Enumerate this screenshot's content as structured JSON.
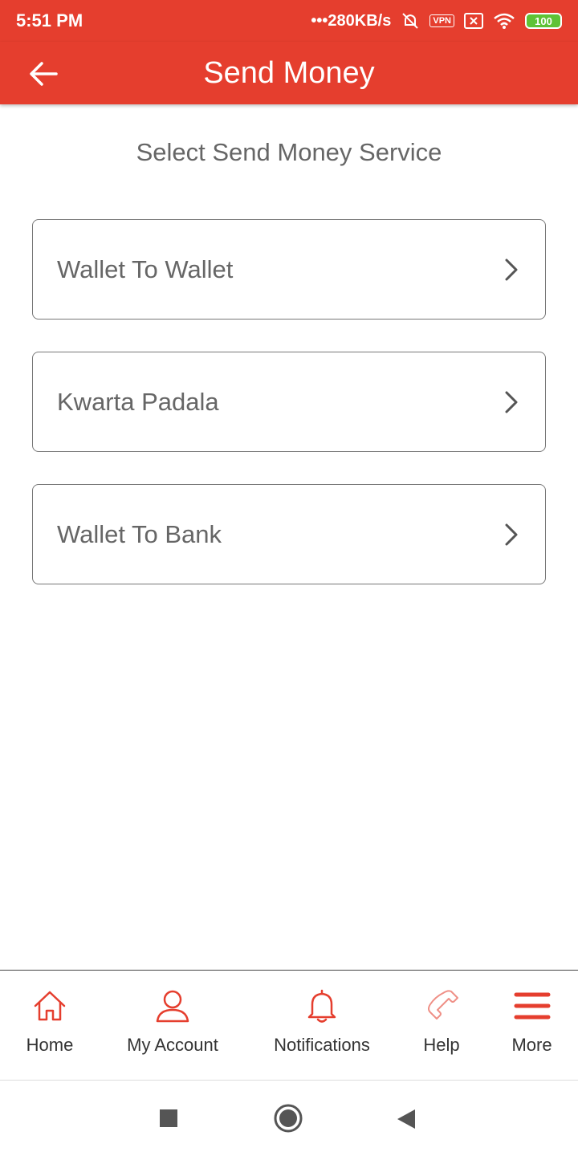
{
  "status_bar": {
    "time": "5:51 PM",
    "network_speed": "•••280KB/s",
    "vpn": "VPN",
    "battery": "100"
  },
  "app_bar": {
    "title": "Send Money"
  },
  "section_title": "Select Send Money Service",
  "options": [
    {
      "label": "Wallet To Wallet"
    },
    {
      "label": "Kwarta Padala"
    },
    {
      "label": "Wallet To Bank"
    }
  ],
  "bottom_nav": {
    "items": [
      {
        "label": "Home",
        "icon": "home-icon"
      },
      {
        "label": "My Account",
        "icon": "user-icon"
      },
      {
        "label": "Notifications",
        "icon": "bell-icon"
      },
      {
        "label": "Help",
        "icon": "phone-icon"
      },
      {
        "label": "More",
        "icon": "menu-icon"
      }
    ]
  },
  "colors": {
    "brand_red": "#e53e2e",
    "text_gray": "#666666"
  }
}
